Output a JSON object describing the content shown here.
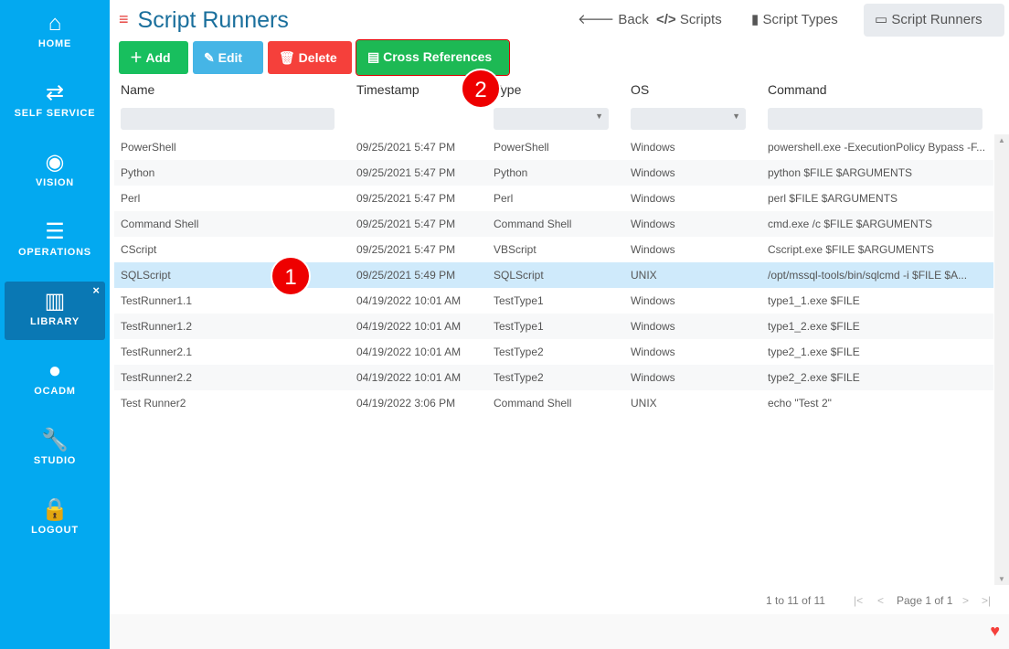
{
  "sidebar": {
    "items": [
      {
        "label": "HOME",
        "icon": "home-icon",
        "glyph": "⌂"
      },
      {
        "label": "SELF SERVICE",
        "icon": "arrows-exchange-icon",
        "glyph": "⇄"
      },
      {
        "label": "VISION",
        "icon": "eye-icon",
        "glyph": "◉"
      },
      {
        "label": "OPERATIONS",
        "icon": "checklist-icon",
        "glyph": "☰"
      },
      {
        "label": "LIBRARY",
        "icon": "books-icon",
        "glyph": "▥",
        "active": true,
        "close": "×"
      },
      {
        "label": "OCADM",
        "icon": "user-icon",
        "glyph": "●"
      },
      {
        "label": "STUDIO",
        "icon": "wrench-icon",
        "glyph": "🔧"
      },
      {
        "label": "LOGOUT",
        "icon": "lock-icon",
        "glyph": "🔒"
      }
    ]
  },
  "header": {
    "title": "Script Runners",
    "menu_glyph": "≡"
  },
  "topnav": {
    "back": "Back",
    "scripts": "Scripts",
    "script_types": "Script Types",
    "script_runners": "Script Runners"
  },
  "toolbar": {
    "add": "Add",
    "edit": "Edit",
    "delete": "Delete",
    "cross_references": "Cross References"
  },
  "colors": {
    "sidebar": "#03a9f0",
    "add": "#18bf5e",
    "edit": "#45b5e6",
    "delete": "#f5403b",
    "cross": "#1db954",
    "selected_row": "#cfeafb"
  },
  "table": {
    "columns": [
      "Name",
      "Timestamp",
      "Type",
      "OS",
      "Command"
    ],
    "rows": [
      [
        "PowerShell",
        "09/25/2021 5:47 PM",
        "PowerShell",
        "Windows",
        "powershell.exe -ExecutionPolicy Bypass -F..."
      ],
      [
        "Python",
        "09/25/2021 5:47 PM",
        "Python",
        "Windows",
        "python $FILE $ARGUMENTS"
      ],
      [
        "Perl",
        "09/25/2021 5:47 PM",
        "Perl",
        "Windows",
        "perl $FILE $ARGUMENTS"
      ],
      [
        "Command Shell",
        "09/25/2021 5:47 PM",
        "Command Shell",
        "Windows",
        "cmd.exe /c $FILE $ARGUMENTS"
      ],
      [
        "CScript",
        "09/25/2021 5:47 PM",
        "VBScript",
        "Windows",
        "Cscript.exe $FILE $ARGUMENTS"
      ],
      [
        "SQLScript",
        "09/25/2021 5:49 PM",
        "SQLScript",
        "UNIX",
        "/opt/mssql-tools/bin/sqlcmd -i $FILE $A..."
      ],
      [
        "TestRunner1.1",
        "04/19/2022 10:01 AM",
        "TestType1",
        "Windows",
        "type1_1.exe $FILE"
      ],
      [
        "TestRunner1.2",
        "04/19/2022 10:01 AM",
        "TestType1",
        "Windows",
        "type1_2.exe $FILE"
      ],
      [
        "TestRunner2.1",
        "04/19/2022 10:01 AM",
        "TestType2",
        "Windows",
        "type2_1.exe $FILE"
      ],
      [
        "TestRunner2.2",
        "04/19/2022 10:01 AM",
        "TestType2",
        "Windows",
        "type2_2.exe $FILE"
      ],
      [
        "Test Runner2",
        "04/19/2022 3:06 PM",
        "Command Shell",
        "UNIX",
        "echo \"Test 2\""
      ]
    ],
    "selected_index": 5
  },
  "pager": {
    "summary": "1 to 11 of 11",
    "page": "Page 1 of 1"
  },
  "markers": [
    "1",
    "2"
  ]
}
